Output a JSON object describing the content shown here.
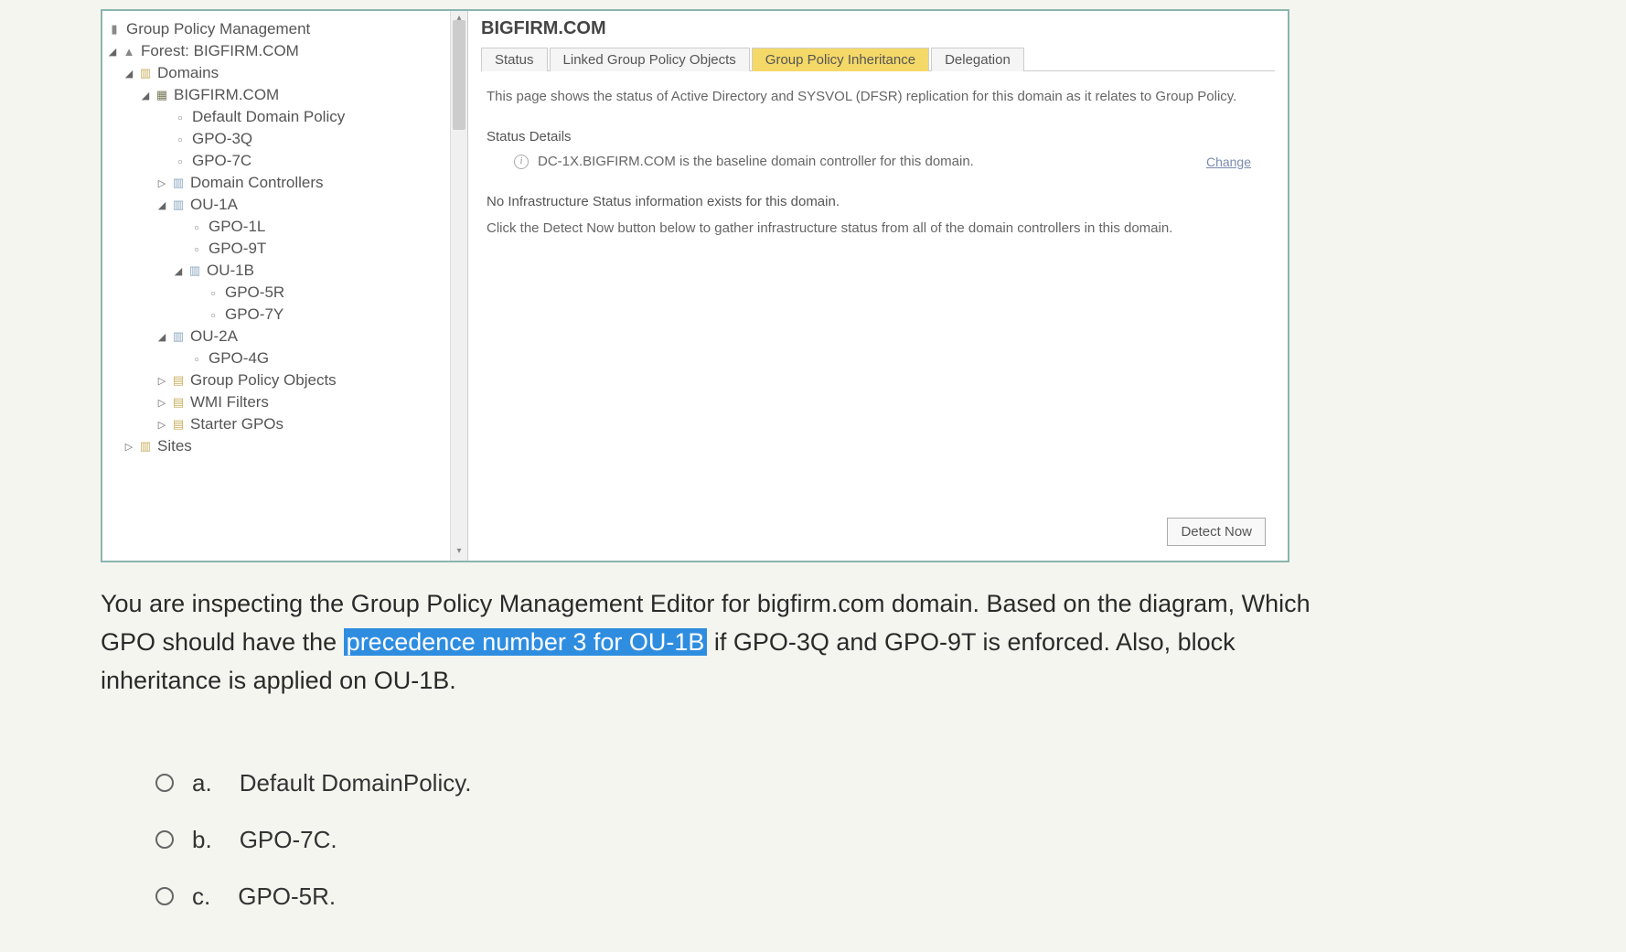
{
  "tree": {
    "root": "Group Policy Management",
    "forest": "Forest: BIGFIRM.COM",
    "domains": "Domains",
    "domain": "BIGFIRM.COM",
    "ddp": "Default Domain Policy",
    "gpo3q": "GPO-3Q",
    "gpo7c": "GPO-7C",
    "dc": "Domain Controllers",
    "ou1a": "OU-1A",
    "gpo1l": "GPO-1L",
    "gpo9t": "GPO-9T",
    "ou1b": "OU-1B",
    "gpo5r": "GPO-5R",
    "gpo7y": "GPO-7Y",
    "ou2a": "OU-2A",
    "gpo4g": "GPO-4G",
    "gpoContainer": "Group Policy Objects",
    "wmi": "WMI Filters",
    "starter": "Starter GPOs",
    "sites": "Sites"
  },
  "content": {
    "title": "BIGFIRM.COM",
    "tabs": {
      "status": "Status",
      "linked": "Linked Group Policy Objects",
      "inheritance": "Group Policy Inheritance",
      "delegation": "Delegation"
    },
    "intro": "This page shows the status of Active Directory and SYSVOL (DFSR) replication for this domain as it relates to Group Policy.",
    "detailsHeader": "Status Details",
    "baseline": "DC-1X.BIGFIRM.COM is the baseline domain controller for this domain.",
    "change": "Change",
    "noInfra": "No Infrastructure Status information exists for this domain.",
    "detectHint": "Click the Detect Now button below to gather infrastructure status from all of the domain controllers in this domain.",
    "detectBtn": "Detect Now"
  },
  "question": {
    "line1_a": "You are inspecting the Group Policy Management Editor for bigfirm.com domain. Based on the diagram, Which",
    "line2_a": "GPO should have the ",
    "line2_hl": "precedence number 3 for OU-1B",
    "line2_b": " if GPO-3Q and GPO-9T is enforced. Also, block",
    "line3": "inheritance is applied on OU-1B.",
    "options": {
      "a_letter": "a.",
      "a_text": "Default DomainPolicy.",
      "b_letter": "b.",
      "b_text": "GPO-7C.",
      "c_letter": "c.",
      "c_text": "GPO-5R."
    }
  }
}
